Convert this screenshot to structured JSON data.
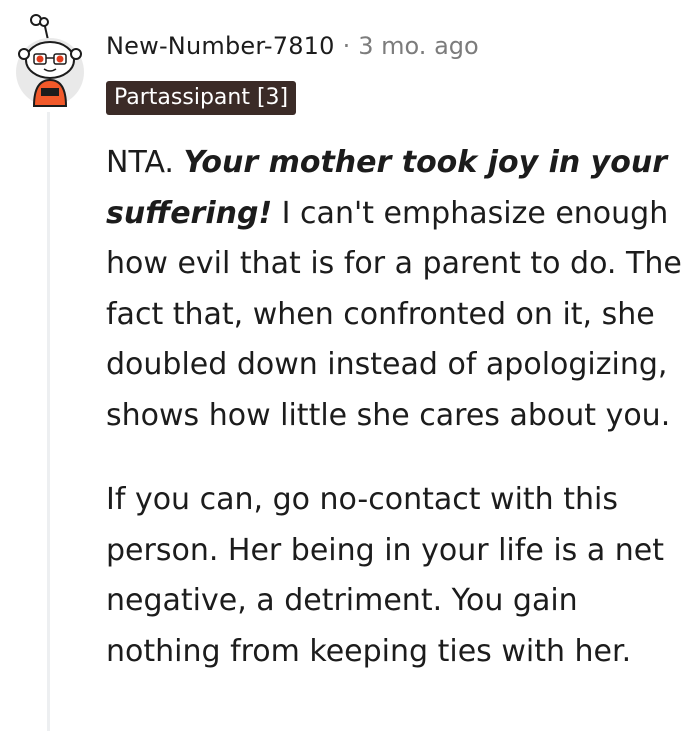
{
  "comment": {
    "author": "New-Number-7810",
    "separator": "·",
    "timestamp": "3 mo. ago",
    "flair": "Partassipant [3]",
    "avatar_icon": "snoo-avatar-icon",
    "paragraphs": [
      {
        "lead": "NTA. ",
        "emphasis": "Your mother took joy in your suffering!",
        "rest": " I can't emphasize enough how evil that is for a parent to do. The fact that, when confronted on it, she doubled down instead of apologizing, shows how little she cares about you."
      },
      {
        "text": "If you can, go no-contact with this person. Her being in your life is a net negative, a detriment. You gain nothing from keeping ties with her."
      }
    ]
  },
  "colors": {
    "flair_bg": "#3b2b27",
    "meta_gray": "#7c7c7c",
    "thread_line": "#edeff1"
  }
}
